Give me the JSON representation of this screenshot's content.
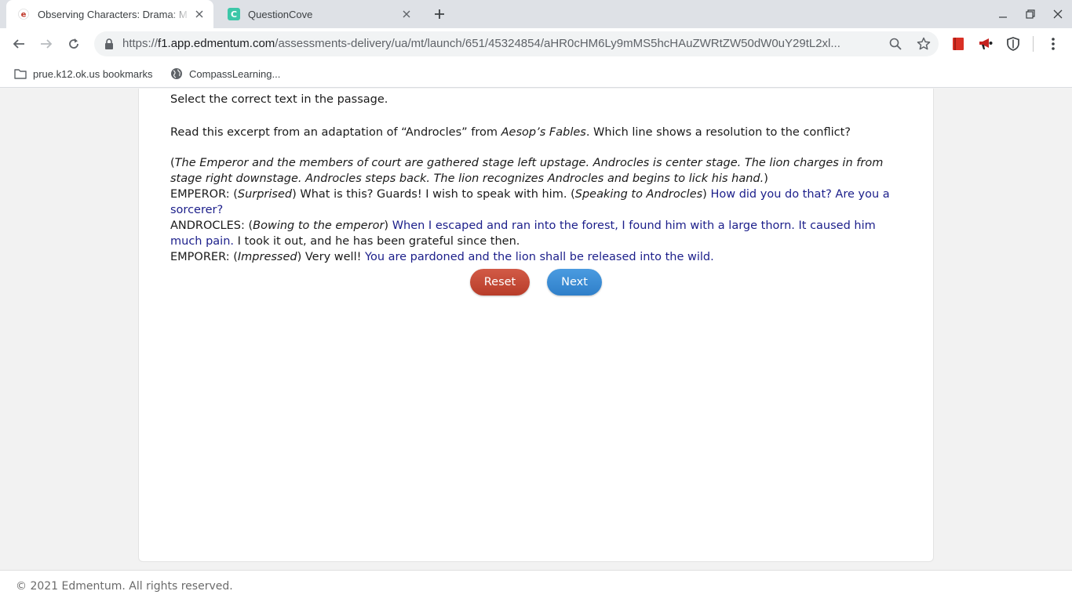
{
  "browser": {
    "tabs": [
      {
        "title": "Observing Characters: Drama: M",
        "icon": "edmentum-favicon",
        "active": true
      },
      {
        "title": "QuestionCove",
        "icon": "questioncove-favicon",
        "active": false
      }
    ],
    "url": {
      "scheme": "https://",
      "host": "f1.app.edmentum.com",
      "path": "/assessments-delivery/ua/mt/launch/651/45324854/aHR0cHM6Ly9mMS5hcHAuZWRtZW50dW0uY29tL2xl..."
    },
    "bookmarks": [
      {
        "label": "prue.k12.ok.us bookmarks",
        "icon": "folder-icon"
      },
      {
        "label": "CompassLearning...",
        "icon": "globe-icon"
      }
    ]
  },
  "question": {
    "instruction": "Select the correct text in the passage.",
    "prompt_before": "Read this excerpt from an adaptation of “Androcles” from ",
    "prompt_title": "Aesop’s Fables",
    "prompt_after": ". Which line shows a resolution to the conflict?",
    "stage_direction": "The Emperor and the members of court are gathered stage left upstage. Androcles is center stage. The lion charges in from stage right downstage. Androcles steps back. The lion recognizes Androcles and begins to lick his hand.",
    "line1": {
      "speaker": "EMPEROR: ",
      "direction1": "Surprised",
      "text1": " What is this? Guards! I wish to speak with him. ",
      "direction2": "Speaking to Androcles",
      "selectable": "How did you do that? Are you a sorcerer?"
    },
    "line2": {
      "speaker": "ANDROCLES: ",
      "direction": "Bowing to the emperor",
      "selectable": "When I escaped and ran into the forest, I found him with a large thorn. It caused him much pain.",
      "text": " I took it out, and he has been grateful since then."
    },
    "line3": {
      "speaker": "EMPORER: ",
      "direction": "Impressed",
      "text": " Very well! ",
      "selectable": "You are pardoned and the lion shall be released into the wild."
    },
    "buttons": {
      "reset": "Reset",
      "next": "Next"
    }
  },
  "footer": {
    "copyright": "© 2021 Edmentum. All rights reserved."
  },
  "colors": {
    "selectable_text": "#1b1e8a",
    "reset_button": "#c4493a",
    "next_button": "#3a8bd4"
  }
}
